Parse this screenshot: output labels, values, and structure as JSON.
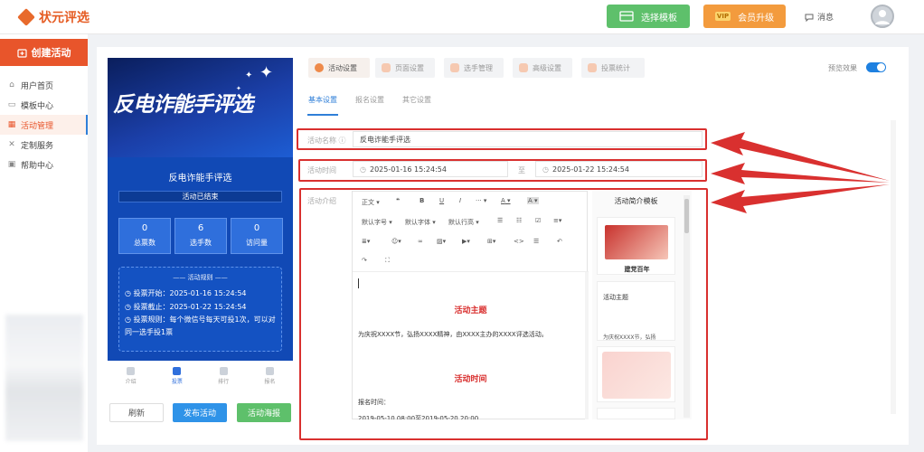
{
  "brand": {
    "name": "状元评选"
  },
  "topbar": {
    "template_button": "选择模板",
    "vip_badge": "VIP",
    "vip_button": "会员升级",
    "messages": "消息"
  },
  "sidebar": {
    "create": "创建活动",
    "items": [
      {
        "label": "用户首页",
        "icon": "home-icon"
      },
      {
        "label": "模板中心",
        "icon": "template-icon"
      },
      {
        "label": "活动管理",
        "icon": "activity-icon"
      },
      {
        "label": "定制服务",
        "icon": "custom-icon"
      },
      {
        "label": "帮助中心",
        "icon": "help-icon"
      }
    ],
    "active_index": 2
  },
  "preview": {
    "banner_title": "反电诈能手评选",
    "activity_name": "反电诈能手评选",
    "status": "活动已结束",
    "stats": [
      {
        "value": "0",
        "label": "总票数"
      },
      {
        "value": "6",
        "label": "选手数"
      },
      {
        "value": "0",
        "label": "访问量"
      }
    ],
    "rules_header": "活动规则",
    "vote_start": "投票开始：2025-01-16 15:24:54",
    "vote_end": "投票截止：2025-01-22 15:24:54",
    "vote_rule": "投票规则：每个微信号每天可投1次，可以对同一选手投1票",
    "tabs": [
      "介绍",
      "投票",
      "排行",
      "报名"
    ],
    "active_tab": 1
  },
  "bottom_buttons": {
    "refresh": "刷新",
    "publish": "发布活动",
    "poster": "活动海报"
  },
  "steps": [
    "活动设置",
    "页面设置",
    "选手管理",
    "高级设置",
    "投票统计"
  ],
  "active_step": 0,
  "preview_toggle": {
    "label": "预览效果",
    "on": true
  },
  "subtabs": [
    "基本设置",
    "报名设置",
    "其它设置"
  ],
  "form": {
    "name_label": "活动名称",
    "name_value": "反电诈能手评选",
    "time_label": "活动时间",
    "time_start": "2025-01-16 15:24:54",
    "time_sep": "至",
    "time_end": "2025-01-22 15:24:54",
    "intro_label": "活动介绍"
  },
  "editor": {
    "toolbar": {
      "para": "正文",
      "quote": "❝",
      "bold": "B",
      "underline": "U",
      "italic": "I",
      "more": "···",
      "color": "A",
      "bg": "A",
      "font_size": "默认字号",
      "font_family": "默认字体",
      "line_height": "默认行高"
    },
    "heading1": "活动主题",
    "para1": "为庆祝XXXX节，弘扬XXXX精神，由XXXX主办的XXXX评选活动。",
    "heading2": "活动时间",
    "para2": "报名时间：",
    "para3": "2019-05-10 08:00至2019-05-20 20:00"
  },
  "templates": {
    "title": "活动简介模板",
    "card1_caption": "建党百年",
    "card2_title": "活动主题",
    "card2_text": "为庆祝XXXX节，弘扬"
  },
  "colors": {
    "accent": "#e8552b",
    "blue": "#2f7fd8",
    "red_box": "#d9302f"
  }
}
